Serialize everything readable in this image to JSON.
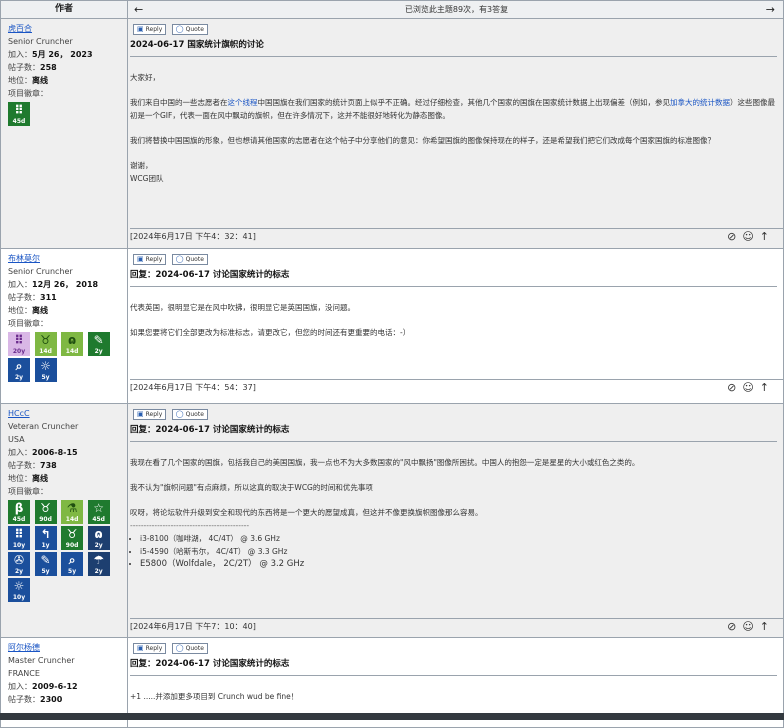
{
  "header": {
    "author_col": "作者",
    "prev_arrow": "←",
    "view_info": "已浏览此主题89次，有3答复",
    "next_arrow": "→"
  },
  "buttons": {
    "reply": "Reply",
    "quote": "Quote"
  },
  "posts": [
    {
      "author": {
        "name": "虎百合",
        "rank": "Senior Cruncher",
        "country": "",
        "joined_label": "加入：",
        "joined": "5月 26， 2023",
        "posts_label": "帖子数：",
        "posts": "258",
        "status_label": "地位：",
        "status": "离线",
        "badges_label": "项目徽章："
      },
      "badges": [
        {
          "icon": "grid-icon",
          "value": "45d"
        }
      ],
      "title": "2024-06-17 国家统计旗帜的讨论",
      "body": {
        "greeting": "大家好，",
        "p2_before": "我们来自中国的一些志愿者在",
        "p2_link1": "这个线程",
        "p2_mid": "中国国旗在我们国家的统计页面上似乎不正确。经过仔细检查，其他几个国家的国旗在国家统计数据上出现偏差（例如，参见",
        "p2_link2": "加拿大的统计数据",
        "p2_after": "）这些图像最初是一个GIF，代表一面在风中飘动的旗帜，但在许多情况下，这并不能很好地转化为静态图像。",
        "p3": "我们将替换中国国旗的形象，但也想请其他国家的志愿者在这个帖子中分享他们的意见：你希望国旗的图像保持现在的样子，还是希望我们把它们改成每个国家国旗的标准图像？",
        "sign1": "谢谢，",
        "sign2": "WCG团队"
      },
      "timestamp": "[2024年6月17日 下午4：32：41]"
    },
    {
      "author": {
        "name": "布林莫尔",
        "rank": "Senior Cruncher",
        "country": "",
        "joined_label": "加入：",
        "joined": "12月 26， 2018",
        "posts_label": "帖子数：",
        "posts": "311",
        "status_label": "地位：",
        "status": "离线",
        "badges_label": "项目徽章："
      },
      "badges": [
        {
          "icon": "grid-icon",
          "value": "20y"
        },
        {
          "icon": "ribbon-icon",
          "value": "14d"
        },
        {
          "icon": "lungs-icon",
          "value": "14d"
        },
        {
          "icon": "tools-icon",
          "value": "2y"
        },
        {
          "icon": "magnifier-icon",
          "value": "2y"
        },
        {
          "icon": "sun-icon",
          "value": "5y"
        }
      ],
      "title": "回复：2024-06-17 讨论国家统计的标志",
      "body": {
        "p1": "代表英国，很明显它是在风中吹拂，很明显它是英国国旗，没问题。",
        "p2": "如果您要将它们全部更改为标准标志，请更改它，但您的时间还有更重要的电话：-）"
      },
      "timestamp": "[2024年6月17日 下午4：54：37]"
    },
    {
      "author": {
        "name": "HCcC",
        "rank": "Veteran Cruncher",
        "country": "USA",
        "joined_label": "加入：",
        "joined": "2006-8-15",
        "posts_label": "帖子数：",
        "posts": "738",
        "status_label": "地位：",
        "status": "离线",
        "badges_label": "项目徽章："
      },
      "badges": [
        {
          "icon": "beta-icon",
          "value": "45d"
        },
        {
          "icon": "ribbon-icon",
          "value": "90d"
        },
        {
          "icon": "flask-icon",
          "value": "14d"
        },
        {
          "icon": "person-icon",
          "value": "45d"
        },
        {
          "icon": "grid-icon",
          "value": "10y"
        },
        {
          "icon": "return-icon",
          "value": "1y"
        },
        {
          "icon": "ribbon-icon",
          "value": "90d"
        },
        {
          "icon": "lungs-icon",
          "value": "2y"
        },
        {
          "icon": "fan-icon",
          "value": "2y"
        },
        {
          "icon": "tools-icon",
          "value": "5y"
        },
        {
          "icon": "magnifier-icon",
          "value": "5y"
        },
        {
          "icon": "umbrella-icon",
          "value": "2y"
        },
        {
          "icon": "sun-icon",
          "value": "10y"
        }
      ],
      "title": "回复：2024-06-17 讨论国家统计的标志",
      "body": {
        "p1": "我现在看了几个国家的国旗，包括我自己的美国国旗，我一点也不为大多数国家的\"风中飘扬\"图像所困扰。中国人的抱怨一定是星星的大小或红色之类的。",
        "p2": "我不认为\"旗帜问题\"有点麻烦，所以这真的取决于WCG的时间和优先事项",
        "p3": "叹呀，将论坛软件升级到安全和现代的东西将是一个更大的愿望成真，但这并不像更换旗帜图像那么容易。",
        "divider": "--------------------------------------------",
        "spec1": "i3-8100（咖啡湖， 4C/4T） @ 3.6 GHz",
        "spec2": "i5-4590（哈斯韦尔， 4C/4T） @ 3.3 GHz",
        "spec3": "E5800（Wolfdale， 2C/2T） @ 3.2 GHz"
      },
      "timestamp": "[2024年6月17日 下午7：10：40]"
    },
    {
      "author": {
        "name": "阿尔杨德",
        "rank": "Master Cruncher",
        "country": "FRANCE",
        "joined_label": "加入：",
        "joined": "2009-6-12",
        "posts_label": "帖子数：",
        "posts": "2300"
      },
      "title": "回复：2024-06-17 讨论国家统计的标志",
      "body": {
        "p1": "+1 .....并添加更多项目到 Crunch wud be fine！"
      }
    }
  ],
  "colors": {
    "badge_green": "#1f7a2e",
    "badge_blue": "#1b4f9c",
    "badge_lightgreen": "#7fb843",
    "badge_purple": "#d9b7e6",
    "badge_darkblue": "#1d3f70",
    "link": "#1a55c4"
  }
}
